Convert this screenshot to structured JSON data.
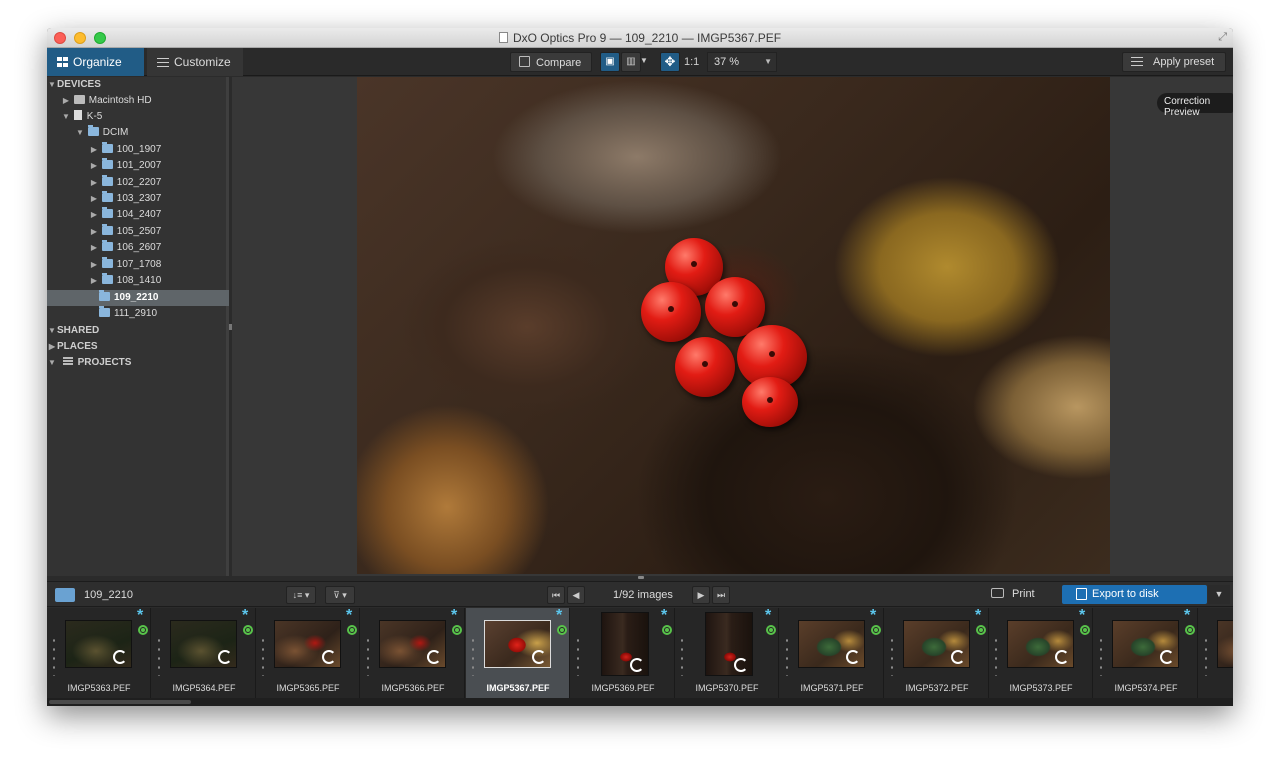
{
  "window": {
    "title": "DxO Optics Pro 9 — 109_2210 — IMGP5367.PEF"
  },
  "toolbar": {
    "tabs": [
      {
        "label": "Organize",
        "active": true
      },
      {
        "label": "Customize",
        "active": false
      }
    ],
    "compare_label": "Compare",
    "ratio_label": "1:1",
    "zoom_value": "37 %",
    "apply_preset_label": "Apply preset"
  },
  "sidebar": {
    "sections": {
      "devices": "DEVICES",
      "shared": "SHARED",
      "places": "PLACES",
      "projects": "PROJECTS"
    },
    "items": {
      "macintosh_hd": "Macintosh HD",
      "k5": "K-5",
      "dcim": "DCIM"
    },
    "folders": [
      {
        "label": "100_1907",
        "selected": false
      },
      {
        "label": "101_2007",
        "selected": false
      },
      {
        "label": "102_2207",
        "selected": false
      },
      {
        "label": "103_2307",
        "selected": false
      },
      {
        "label": "104_2407",
        "selected": false
      },
      {
        "label": "105_2507",
        "selected": false
      },
      {
        "label": "106_2607",
        "selected": false
      },
      {
        "label": "107_1708",
        "selected": false
      },
      {
        "label": "108_1410",
        "selected": false
      },
      {
        "label": "109_2210",
        "selected": true
      },
      {
        "label": "111_2910",
        "selected": false
      }
    ]
  },
  "viewer": {
    "preview_label": "Correction Preview"
  },
  "navbar": {
    "folder_name": "109_2210",
    "image_count": "1/92 images",
    "print_label": "Print",
    "export_label": "Export to disk"
  },
  "filmstrip": {
    "thumbnails": [
      {
        "label": "IMGP5363.PEF",
        "selected": false,
        "orientation": "landscape",
        "style": "dark"
      },
      {
        "label": "IMGP5364.PEF",
        "selected": false,
        "orientation": "landscape",
        "style": "dark"
      },
      {
        "label": "IMGP5365.PEF",
        "selected": false,
        "orientation": "landscape",
        "style": "leaves"
      },
      {
        "label": "IMGP5366.PEF",
        "selected": false,
        "orientation": "landscape",
        "style": "leaves"
      },
      {
        "label": "IMGP5367.PEF",
        "selected": true,
        "orientation": "landscape",
        "style": "berries"
      },
      {
        "label": "IMGP5369.PEF",
        "selected": false,
        "orientation": "portrait",
        "style": "stem"
      },
      {
        "label": "IMGP5370.PEF",
        "selected": false,
        "orientation": "portrait",
        "style": "stem"
      },
      {
        "label": "IMGP5371.PEF",
        "selected": false,
        "orientation": "landscape",
        "style": "green"
      },
      {
        "label": "IMGP5372.PEF",
        "selected": false,
        "orientation": "landscape",
        "style": "green"
      },
      {
        "label": "IMGP5373.PEF",
        "selected": false,
        "orientation": "landscape",
        "style": "green"
      },
      {
        "label": "IMGP5374.PEF",
        "selected": false,
        "orientation": "landscape",
        "style": "green"
      },
      {
        "label": "IMG",
        "selected": false,
        "orientation": "landscape",
        "style": "leaves"
      }
    ]
  },
  "colors": {
    "accent_blue": "#215c86",
    "export_blue": "#1d6fb3",
    "status_green": "#58c34a",
    "star_blue": "#5cc6ec",
    "selection_gray": "#5f6569"
  }
}
